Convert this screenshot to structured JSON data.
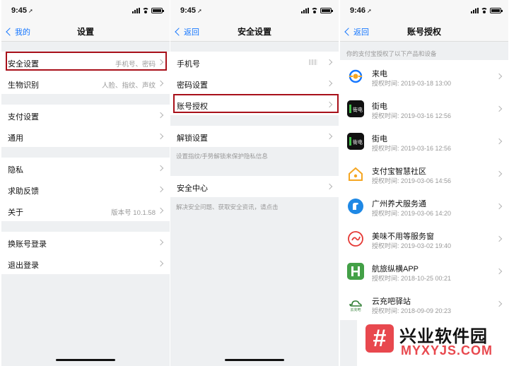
{
  "screen1": {
    "time": "9:45",
    "back_label": "我的",
    "title": "设置",
    "rows": [
      {
        "label": "安全设置",
        "value": "手机号、密码"
      },
      {
        "label": "生物识别",
        "value": "人脸、指纹、声纹"
      },
      {
        "label": "支付设置",
        "value": ""
      },
      {
        "label": "通用",
        "value": ""
      },
      {
        "label": "隐私",
        "value": ""
      },
      {
        "label": "求助反馈",
        "value": ""
      },
      {
        "label": "关于",
        "value": "版本号 10.1.58"
      },
      {
        "label": "换账号登录",
        "value": ""
      },
      {
        "label": "退出登录",
        "value": ""
      }
    ]
  },
  "screen2": {
    "time": "9:45",
    "back_label": "返回",
    "title": "安全设置",
    "rows": [
      {
        "label": "手机号"
      },
      {
        "label": "密码设置"
      },
      {
        "label": "账号授权"
      },
      {
        "label": "解锁设置"
      },
      {
        "label": "安全中心"
      }
    ],
    "notes": {
      "unlock": "设置指纹/手势解锁来保护隐私信息",
      "security": "解决安全问题、获取安全资讯，请点击"
    }
  },
  "screen3": {
    "time": "9:46",
    "back_label": "返回",
    "title": "账号授权",
    "header": "你的支付宝授权了以下产品和设备",
    "apps": [
      {
        "name": "来电",
        "time": "授权时间: 2019-03-18 13:00",
        "icon": "laidian-icon"
      },
      {
        "name": "街电",
        "time": "授权时间: 2019-03-16 12:56",
        "icon": "jiedian-icon",
        "icon_text": "街电"
      },
      {
        "name": "街电",
        "time": "授权时间: 2019-03-16 12:56",
        "icon": "jiedian-icon",
        "icon_text": "街电"
      },
      {
        "name": "支付宝智慧社区",
        "time": "授权时间: 2019-03-06 14:56",
        "icon": "house-icon"
      },
      {
        "name": "广州养犬服务通",
        "time": "授权时间: 2019-03-06 14:20",
        "icon": "dog-service-icon"
      },
      {
        "name": "美味不用等服务窗",
        "time": "授权时间: 2019-03-02 19:40",
        "icon": "meiwei-icon"
      },
      {
        "name": "航旅纵横APP",
        "time": "授权时间: 2018-10-25 00:21",
        "icon": "hanglv-icon"
      },
      {
        "name": "云充吧驿站",
        "time": "授权时间: 2018-09-09 20:23",
        "icon": "cloud-charge-icon",
        "icon_text": "云充吧"
      }
    ]
  },
  "watermark": {
    "cn": "兴业软件园",
    "en": "MYXYJS.COM",
    "logo": "#"
  },
  "colors": {
    "accent": "#1677ff",
    "highlight": "#a8101a",
    "jiedian_green": "#43c34a",
    "watermark_red": "#e8484e"
  }
}
